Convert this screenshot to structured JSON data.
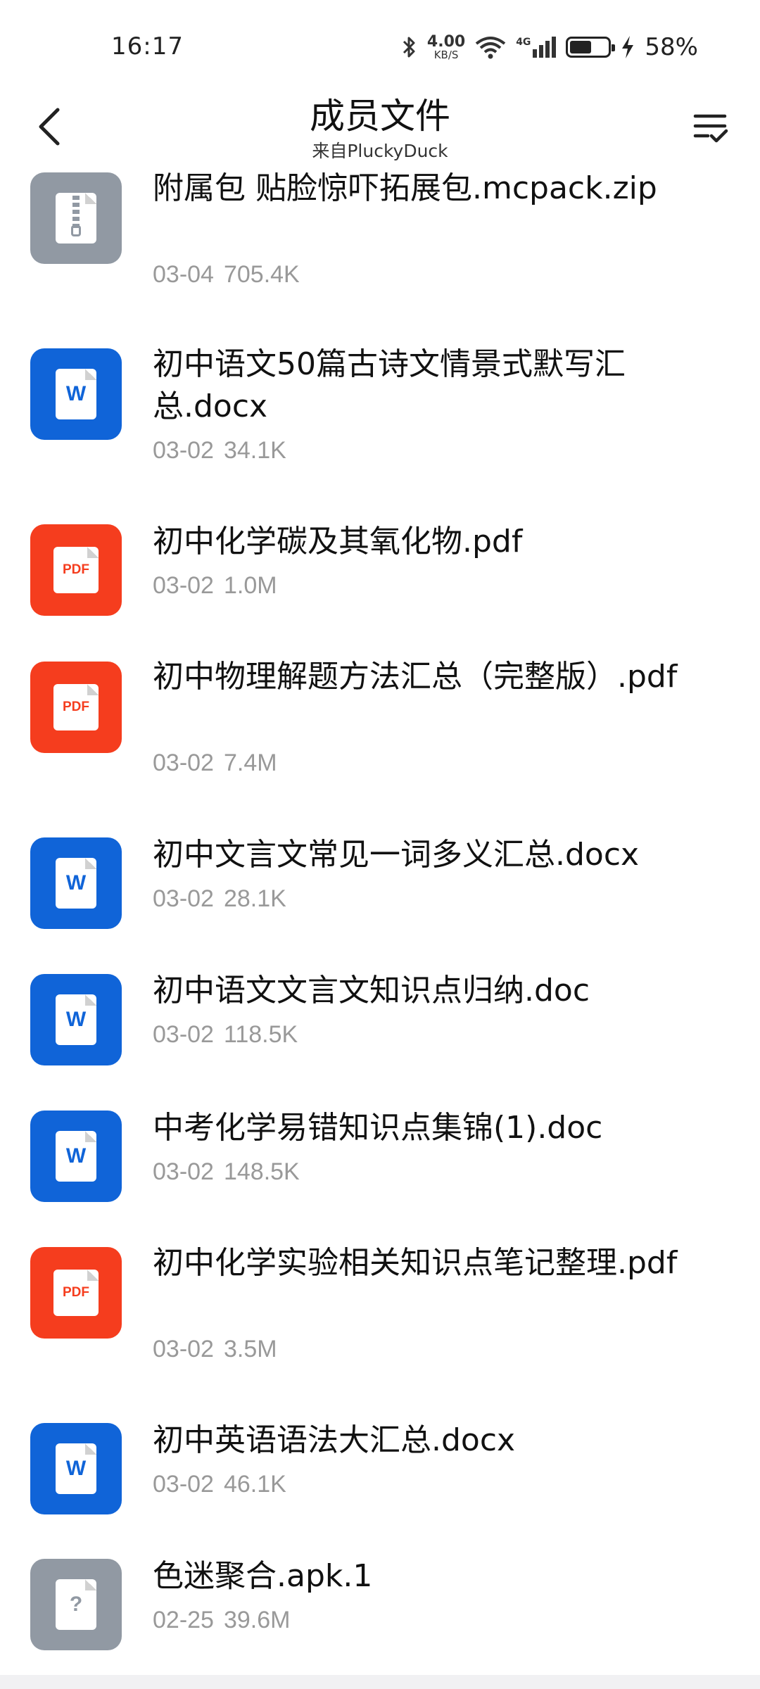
{
  "status_bar": {
    "time": "16:17",
    "net_speed_value": "4.00",
    "net_speed_unit": "KB/S",
    "network": "4G",
    "battery_percent": "58%",
    "battery_level": 0.58
  },
  "header": {
    "title": "成员文件",
    "subtitle": "来自PluckyDuck"
  },
  "files": [
    {
      "type": "zip",
      "icon": "zip-icon",
      "name": "附属包 贴脸惊吓拓展包.mcpack.zip",
      "date": "03-04",
      "size": "705.4K"
    },
    {
      "type": "word",
      "icon": "word-icon",
      "name": "初中语文50篇古诗文情景式默写汇总.docx",
      "date": "03-02",
      "size": "34.1K"
    },
    {
      "type": "pdf",
      "icon": "pdf-icon",
      "name": "初中化学碳及其氧化物.pdf",
      "date": "03-02",
      "size": "1.0M"
    },
    {
      "type": "pdf",
      "icon": "pdf-icon",
      "name": "初中物理解题方法汇总（完整版）.pdf",
      "date": "03-02",
      "size": "7.4M"
    },
    {
      "type": "word",
      "icon": "word-icon",
      "name": "初中文言文常见一词多义汇总.docx",
      "date": "03-02",
      "size": "28.1K"
    },
    {
      "type": "word",
      "icon": "word-icon",
      "name": "初中语文文言文知识点归纳.doc",
      "date": "03-02",
      "size": "118.5K"
    },
    {
      "type": "word",
      "icon": "word-icon",
      "name": "中考化学易错知识点集锦(1).doc",
      "date": "03-02",
      "size": "148.5K"
    },
    {
      "type": "pdf",
      "icon": "pdf-icon",
      "name": "初中化学实验相关知识点笔记整理.pdf",
      "date": "03-02",
      "size": "3.5M"
    },
    {
      "type": "word",
      "icon": "word-icon",
      "name": "初中英语语法大汇总.docx",
      "date": "03-02",
      "size": "46.1K"
    },
    {
      "type": "unk",
      "icon": "unknown-file-icon",
      "name": "色迷聚合.apk.1",
      "date": "02-25",
      "size": "39.6M"
    }
  ],
  "icon_labels": {
    "word": "W",
    "pdf": "PDF",
    "unk": "?"
  },
  "colors": {
    "word": "#1064d8",
    "pdf": "#f53d1e",
    "zip": "#9199a3",
    "unknown": "#9199a3"
  }
}
